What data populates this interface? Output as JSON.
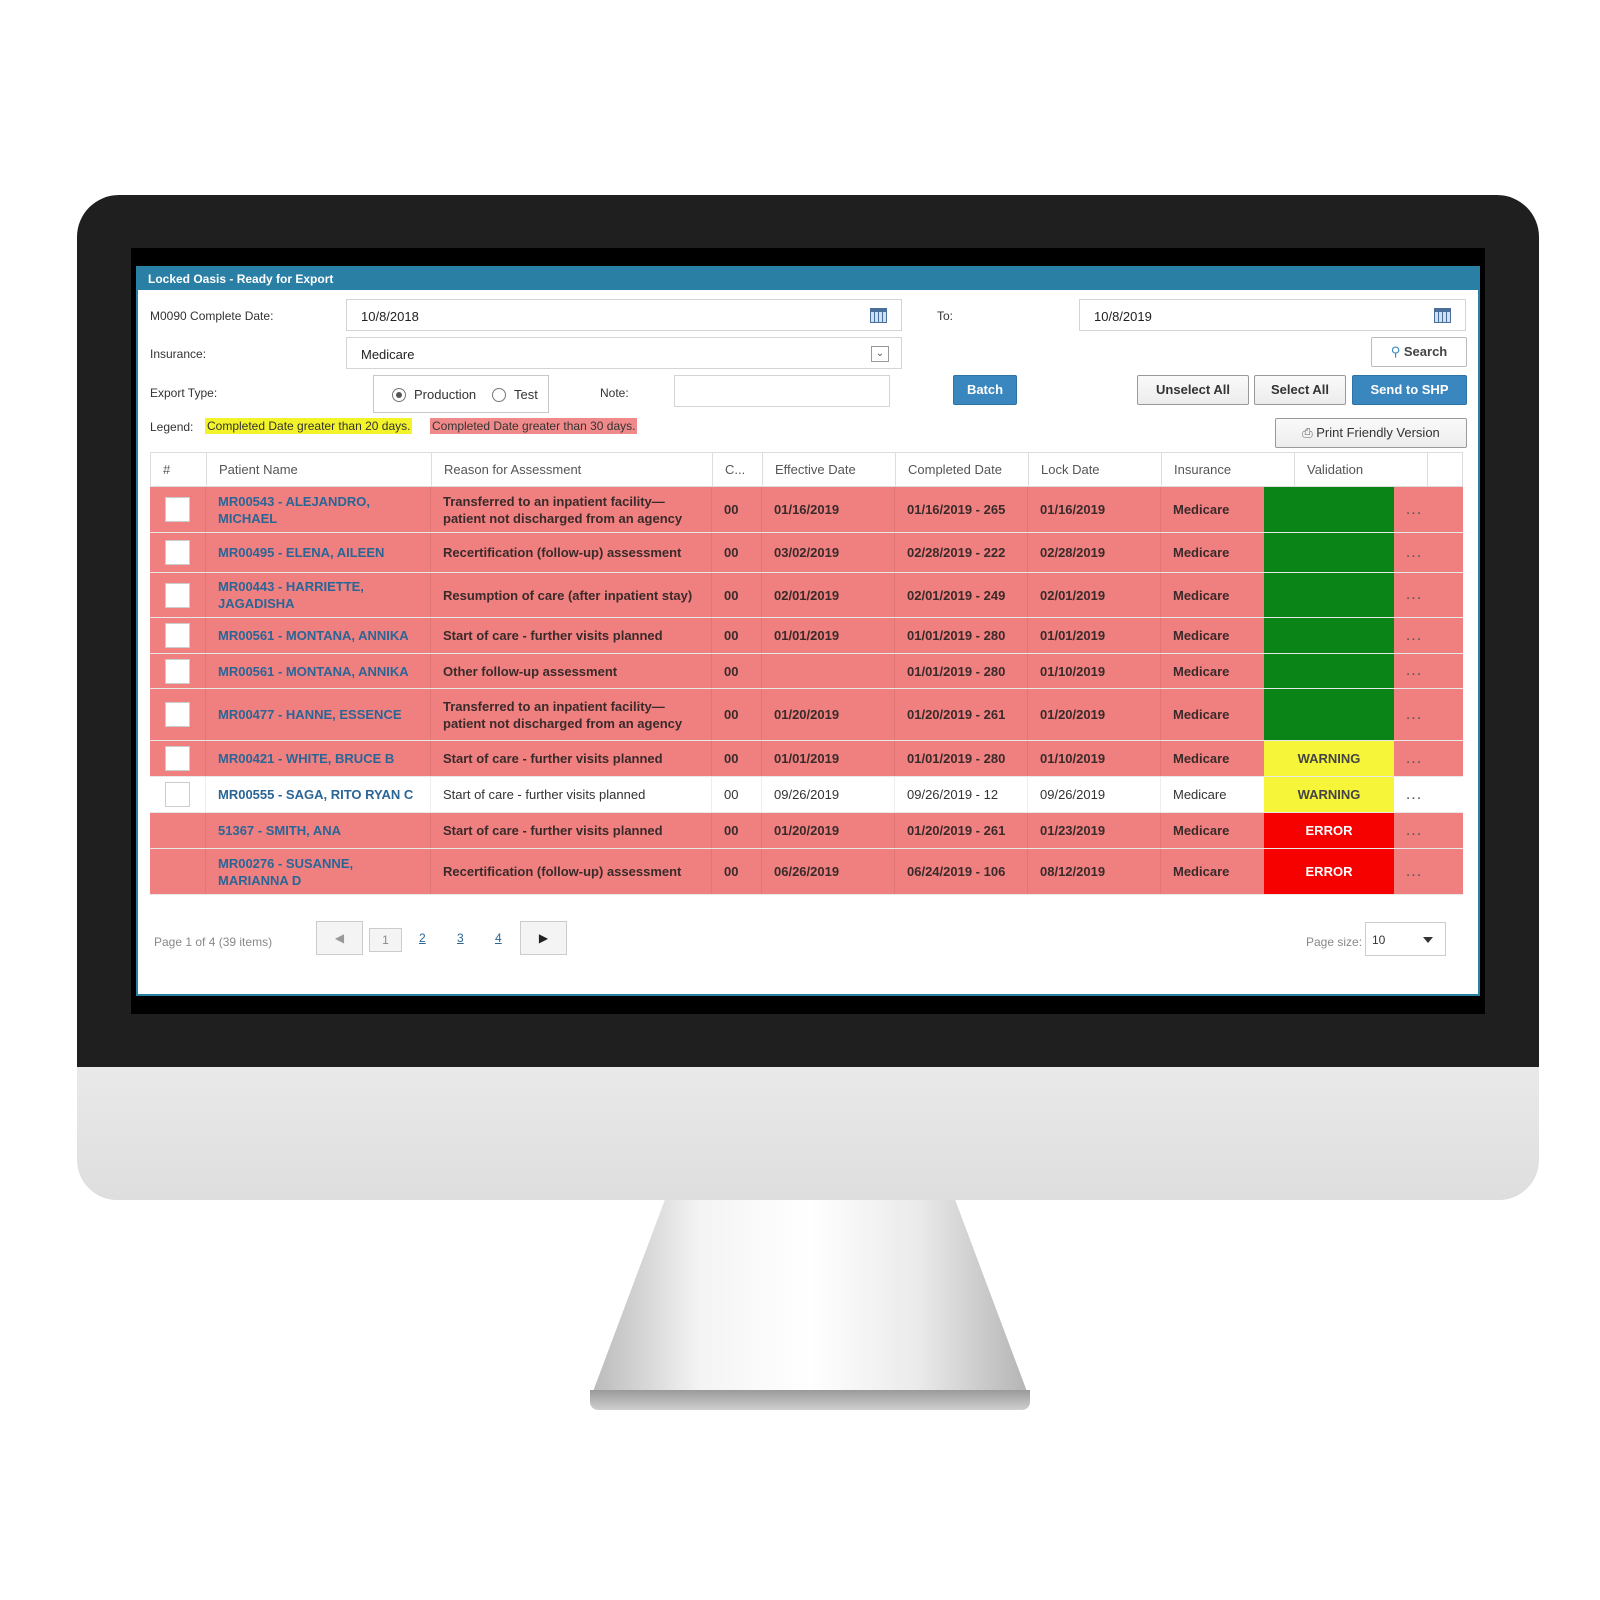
{
  "window": {
    "title": "Locked Oasis - Ready for Export"
  },
  "filters": {
    "complete_date_label": "M0090 Complete Date:",
    "from_date": "10/8/2018",
    "to_label": "To:",
    "to_date": "10/8/2019",
    "insurance_label": "Insurance:",
    "insurance_value": "Medicare",
    "export_type_label": "Export Type:",
    "export_options": [
      "Production",
      "Test"
    ],
    "export_selected": "Production",
    "note_label": "Note:",
    "note_value": "",
    "legend_label": "Legend:",
    "legend_yellow": "Completed Date greater than 20 days.",
    "legend_red": "Completed Date greater than 30 days."
  },
  "buttons": {
    "search": "Search",
    "batch": "Batch",
    "unselect_all": "Unselect All",
    "select_all": "Select All",
    "send": "Send to SHP",
    "print": "Print Friendly Version"
  },
  "table": {
    "headers": [
      "#",
      "Patient Name",
      "Reason for Assessment",
      "C...",
      "Effective Date",
      "Completed Date",
      "Lock Date",
      "Insurance",
      "Validation"
    ],
    "rows": [
      {
        "name": "MR00543 - ALEJANDRO, MICHAEL",
        "reason": "Transferred to an inpatient facility—patient not discharged from an agency",
        "c": "00",
        "effective": "01/16/2019",
        "completed": "01/16/2019 - 265",
        "lock": "01/16/2019",
        "insurance": "Medicare",
        "validation": ""
      },
      {
        "name": "MR00495 - ELENA, AILEEN",
        "reason": "Recertification (follow-up) assessment",
        "c": "00",
        "effective": "03/02/2019",
        "completed": "02/28/2019 - 222",
        "lock": "02/28/2019",
        "insurance": "Medicare",
        "validation": ""
      },
      {
        "name": "MR00443 - HARRIETTE, JAGADISHA",
        "reason": "Resumption of care (after inpatient stay)",
        "c": "00",
        "effective": "02/01/2019",
        "completed": "02/01/2019 - 249",
        "lock": "02/01/2019",
        "insurance": "Medicare",
        "validation": ""
      },
      {
        "name": "MR00561 - MONTANA, ANNIKA",
        "reason": "Start of care - further visits planned",
        "c": "00",
        "effective": "01/01/2019",
        "completed": "01/01/2019 - 280",
        "lock": "01/01/2019",
        "insurance": "Medicare",
        "validation": ""
      },
      {
        "name": "MR00561 - MONTANA, ANNIKA",
        "reason": "Other follow-up assessment",
        "c": "00",
        "effective": "",
        "completed": "01/01/2019 - 280",
        "lock": "01/10/2019",
        "insurance": "Medicare",
        "validation": ""
      },
      {
        "name": "MR00477 - HANNE, ESSENCE",
        "reason": "Transferred to an inpatient facility—patient not discharged from an agency",
        "c": "00",
        "effective": "01/20/2019",
        "completed": "01/20/2019 - 261",
        "lock": "01/20/2019",
        "insurance": "Medicare",
        "validation": ""
      },
      {
        "name": "MR00421 - WHITE, BRUCE B",
        "reason": "Start of care - further visits planned",
        "c": "00",
        "effective": "01/01/2019",
        "completed": "01/01/2019 - 280",
        "lock": "01/10/2019",
        "insurance": "Medicare",
        "validation": "WARNING"
      },
      {
        "name": "MR00555 - SAGA, RITO RYAN C",
        "reason": "Start of care - further visits planned",
        "c": "00",
        "effective": "09/26/2019",
        "completed": "09/26/2019 - 12",
        "lock": "09/26/2019",
        "insurance": "Medicare",
        "validation": "WARNING"
      },
      {
        "name": "51367 - SMITH, ANA",
        "reason": "Start of care - further visits planned",
        "c": "00",
        "effective": "01/20/2019",
        "completed": "01/20/2019 - 261",
        "lock": "01/23/2019",
        "insurance": "Medicare",
        "validation": "ERROR"
      },
      {
        "name": "MR00276 - SUSANNE, MARIANNA D",
        "reason": "Recertification (follow-up) assessment",
        "c": "00",
        "effective": "06/26/2019",
        "completed": "06/24/2019 - 106",
        "lock": "08/12/2019",
        "insurance": "Medicare",
        "validation": "ERROR"
      }
    ],
    "row_more": "..."
  },
  "pager": {
    "info": "Page 1 of 4 (39 items)",
    "pages": [
      "1",
      "2",
      "3",
      "4"
    ],
    "page_size_label": "Page size:",
    "page_size": "10"
  },
  "colors": {
    "accent": "#2a7fa5",
    "row_red": "#f08080",
    "valid_green": "#0a8416",
    "warn_yellow": "#f6f53a",
    "error_red": "#f60000"
  }
}
